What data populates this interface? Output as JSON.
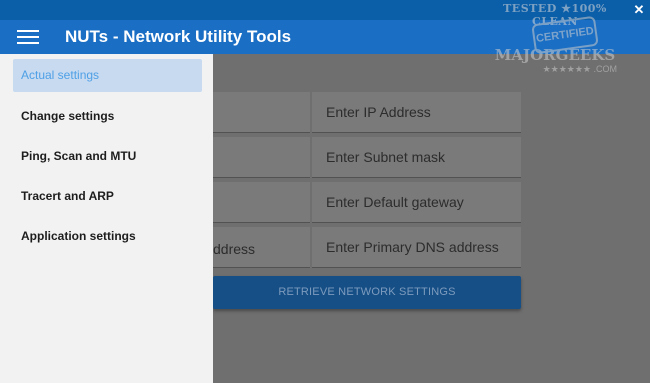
{
  "window": {
    "close_glyph": "✕"
  },
  "appbar": {
    "title": "NUTs - Network Utility Tools",
    "menu_icon": "hamburger-icon"
  },
  "watermark": {
    "top": "TESTED ★100% CLEAN",
    "badge": "CERTIFIED",
    "brand": "MAJORGEEKS",
    "stars": "★★★★★★",
    "com": ".COM"
  },
  "form": {
    "ip_placeholder": "Enter IP Address",
    "subnet_placeholder": "Enter Subnet mask",
    "gateway_placeholder": "Enter Default gateway",
    "dns_placeholder": "Enter Primary DNS address",
    "partial_visible_text": "ddress",
    "retrieve_button": "RETRIEVE NETWORK SETTINGS"
  },
  "drawer": {
    "items": [
      {
        "label": "Actual settings",
        "active": true
      },
      {
        "label": "Change settings",
        "active": false
      },
      {
        "label": "Ping, Scan and MTU",
        "active": false
      },
      {
        "label": "Tracert and ARP",
        "active": false
      },
      {
        "label": "Application settings",
        "active": false
      }
    ]
  },
  "colors": {
    "accent": "#1a6ec4",
    "titlebar": "#0b5ea8",
    "drawer_bg": "#f2f2f2",
    "active_bg": "#c7daf0",
    "active_text": "#4fa0e6"
  }
}
